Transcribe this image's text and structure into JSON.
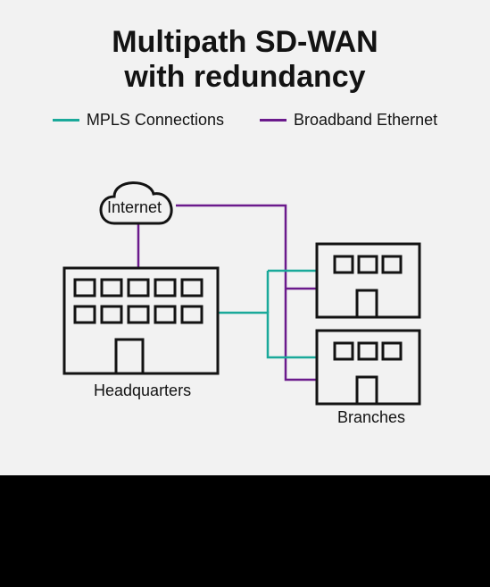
{
  "title_line1": "Multipath SD-WAN",
  "title_line2": "with redundancy",
  "legend": {
    "mpls": "MPLS Connections",
    "broadband": "Broadband Ethernet"
  },
  "nodes": {
    "internet": "Internet",
    "headquarters": "Headquarters",
    "branches": "Branches"
  },
  "colors": {
    "mpls": "#1aa99a",
    "broadband": "#6b1a8c",
    "stroke": "#131313"
  }
}
